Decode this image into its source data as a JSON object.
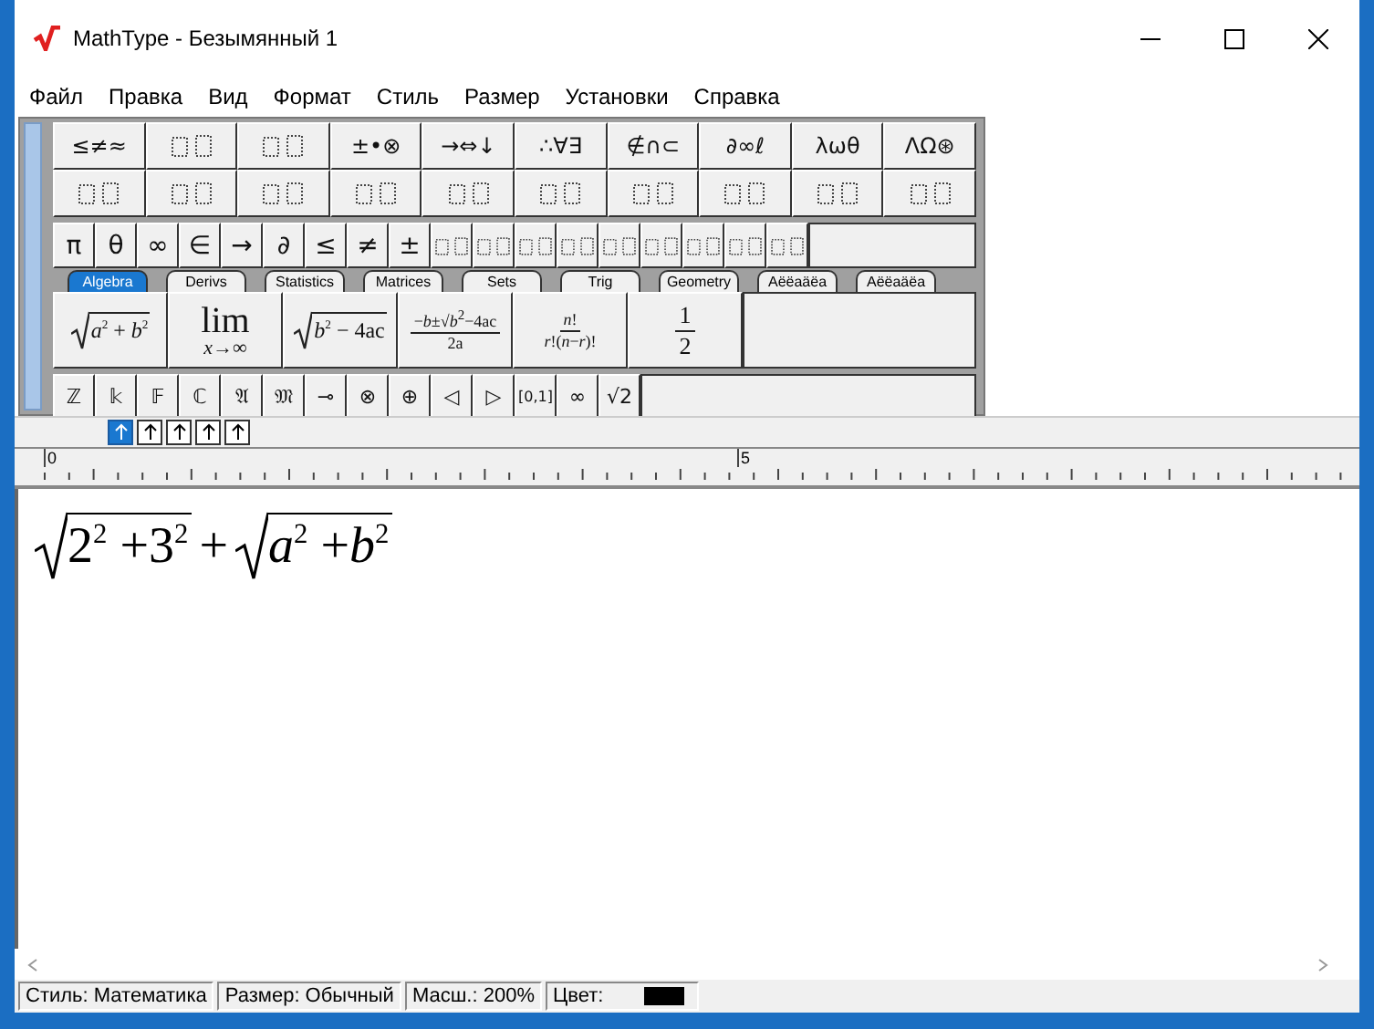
{
  "window": {
    "title": "MathType - Безымянный 1"
  },
  "menu": [
    "Файл",
    "Правка",
    "Вид",
    "Формат",
    "Стиль",
    "Размер",
    "Установки",
    "Справка"
  ],
  "palette": {
    "symbol_rows": [
      [
        {
          "kind": "text",
          "label": "≤≠≈"
        },
        {
          "kind": "icon"
        },
        {
          "kind": "icon"
        },
        {
          "kind": "text",
          "label": "±•⊗"
        },
        {
          "kind": "text",
          "label": "→⇔↓"
        },
        {
          "kind": "text",
          "label": "∴∀∃"
        },
        {
          "kind": "text",
          "label": "∉∩⊂"
        },
        {
          "kind": "text",
          "label": "∂∞ℓ"
        },
        {
          "kind": "text",
          "label": "λωθ"
        },
        {
          "kind": "text",
          "label": "ΛΩ⊛"
        }
      ],
      [
        {
          "kind": "icon"
        },
        {
          "kind": "icon"
        },
        {
          "kind": "icon"
        },
        {
          "kind": "icon"
        },
        {
          "kind": "icon"
        },
        {
          "kind": "icon"
        },
        {
          "kind": "icon"
        },
        {
          "kind": "icon"
        },
        {
          "kind": "icon"
        },
        {
          "kind": "icon"
        }
      ],
      [
        {
          "kind": "text",
          "label": "π"
        },
        {
          "kind": "text",
          "label": "θ"
        },
        {
          "kind": "text",
          "label": "∞"
        },
        {
          "kind": "text",
          "label": "∈"
        },
        {
          "kind": "text",
          "label": "→"
        },
        {
          "kind": "text",
          "label": "∂"
        },
        {
          "kind": "text",
          "label": "≤"
        },
        {
          "kind": "text",
          "label": "≠"
        },
        {
          "kind": "text",
          "label": "±"
        },
        {
          "kind": "icon"
        },
        {
          "kind": "icon"
        },
        {
          "kind": "icon"
        },
        {
          "kind": "icon"
        },
        {
          "kind": "icon"
        },
        {
          "kind": "icon"
        },
        {
          "kind": "icon"
        },
        {
          "kind": "icon"
        },
        {
          "kind": "icon"
        }
      ]
    ],
    "tabs": [
      {
        "label": "Algebra",
        "selected": true
      },
      {
        "label": "Derivs",
        "selected": false
      },
      {
        "label": "Statistics",
        "selected": false
      },
      {
        "label": "Matrices",
        "selected": false
      },
      {
        "label": "Sets",
        "selected": false
      },
      {
        "label": "Trig",
        "selected": false
      },
      {
        "label": "Geometry",
        "selected": false
      },
      {
        "label": "Aëëaäëa",
        "selected": false
      },
      {
        "label": "Aëëaäëa",
        "selected": false
      }
    ],
    "templates": [
      {
        "kind": "sqrt",
        "content": "*a*$^{2}$ + *b*$^{2}$"
      },
      {
        "kind": "limit",
        "content": "lim",
        "below": "*x*→∞"
      },
      {
        "kind": "sqrt",
        "content": "*b*$^{2}$ − 4ac"
      },
      {
        "kind": "fraction",
        "numerator": "−*b*±√*b*$^{2}$−4ac",
        "denominator": "2a"
      },
      {
        "kind": "fraction",
        "numerator": "*n*!",
        "denominator": "*r*!(*n*−*r*)!"
      },
      {
        "kind": "fraction",
        "numerator": "1",
        "denominator": "2"
      }
    ],
    "symbols": [
      "ℤ",
      "𝕜",
      "𝔽",
      "ℂ",
      "𝔄",
      "𝔐",
      "⊸",
      "⊗",
      "⊕",
      "◁",
      "▷",
      "[0,1]",
      "∞",
      "√2"
    ]
  },
  "nudge_buttons": [
    {
      "selected": true
    },
    {
      "selected": false
    },
    {
      "selected": false
    },
    {
      "selected": false
    },
    {
      "selected": false
    }
  ],
  "ruler": {
    "labels": [
      "0",
      "5"
    ]
  },
  "equation": [
    {
      "kind": "sqrt",
      "content": "2$^{2}$ +3$^{2}$"
    },
    {
      "kind": "op",
      "content": "+"
    },
    {
      "kind": "sqrt",
      "content": "*a*$^{2}$ +*b*$^{2}$"
    }
  ],
  "status_bar": [
    {
      "kind": "text",
      "text": "Стиль: Математика"
    },
    {
      "kind": "text",
      "text": "Размер: Обычный"
    },
    {
      "kind": "text",
      "text": "Масш.: 200%"
    },
    {
      "kind": "color",
      "text": "Цвет:",
      "color": "#000000"
    }
  ]
}
